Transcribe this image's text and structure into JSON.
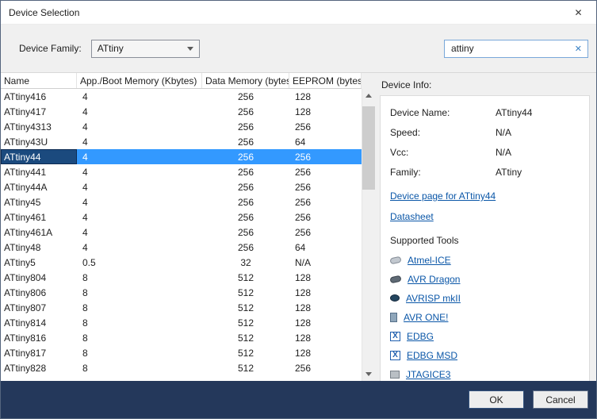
{
  "window": {
    "title": "Device Selection",
    "close_glyph": "✕"
  },
  "toolbar": {
    "device_family_label": "Device Family:",
    "device_family_value": "ATtiny",
    "search_value": "attiny",
    "search_clear": "✕"
  },
  "table": {
    "columns": [
      "Name",
      "App./Boot Memory (Kbytes)",
      "Data Memory (bytes)",
      "EEPROM (bytes)"
    ],
    "rows": [
      {
        "name": "ATtiny416",
        "app_boot": "4",
        "data_mem": "256",
        "eeprom": "128"
      },
      {
        "name": "ATtiny417",
        "app_boot": "4",
        "data_mem": "256",
        "eeprom": "128"
      },
      {
        "name": "ATtiny4313",
        "app_boot": "4",
        "data_mem": "256",
        "eeprom": "256"
      },
      {
        "name": "ATtiny43U",
        "app_boot": "4",
        "data_mem": "256",
        "eeprom": "64"
      },
      {
        "name": "ATtiny44",
        "app_boot": "4",
        "data_mem": "256",
        "eeprom": "256",
        "selected": true
      },
      {
        "name": "ATtiny441",
        "app_boot": "4",
        "data_mem": "256",
        "eeprom": "256"
      },
      {
        "name": "ATtiny44A",
        "app_boot": "4",
        "data_mem": "256",
        "eeprom": "256"
      },
      {
        "name": "ATtiny45",
        "app_boot": "4",
        "data_mem": "256",
        "eeprom": "256"
      },
      {
        "name": "ATtiny461",
        "app_boot": "4",
        "data_mem": "256",
        "eeprom": "256"
      },
      {
        "name": "ATtiny461A",
        "app_boot": "4",
        "data_mem": "256",
        "eeprom": "256"
      },
      {
        "name": "ATtiny48",
        "app_boot": "4",
        "data_mem": "256",
        "eeprom": "64"
      },
      {
        "name": "ATtiny5",
        "app_boot": "0.5",
        "data_mem": "32",
        "eeprom": "N/A"
      },
      {
        "name": "ATtiny804",
        "app_boot": "8",
        "data_mem": "512",
        "eeprom": "128"
      },
      {
        "name": "ATtiny806",
        "app_boot": "8",
        "data_mem": "512",
        "eeprom": "128"
      },
      {
        "name": "ATtiny807",
        "app_boot": "8",
        "data_mem": "512",
        "eeprom": "128"
      },
      {
        "name": "ATtiny814",
        "app_boot": "8",
        "data_mem": "512",
        "eeprom": "128"
      },
      {
        "name": "ATtiny816",
        "app_boot": "8",
        "data_mem": "512",
        "eeprom": "128"
      },
      {
        "name": "ATtiny817",
        "app_boot": "8",
        "data_mem": "512",
        "eeprom": "128"
      },
      {
        "name": "ATtiny828",
        "app_boot": "8",
        "data_mem": "512",
        "eeprom": "256"
      }
    ],
    "selected_device": "ATtiny44"
  },
  "device_info": {
    "title": "Device Info:",
    "fields": [
      {
        "label": "Device Name:",
        "value": "ATtiny44"
      },
      {
        "label": "Speed:",
        "value": "N/A"
      },
      {
        "label": "Vcc:",
        "value": "N/A"
      },
      {
        "label": "Family:",
        "value": "ATtiny"
      }
    ],
    "links": [
      {
        "label": "Device page for ATtiny44"
      },
      {
        "label": "Datasheet"
      }
    ],
    "supported_tools_title": "Supported Tools",
    "tools": [
      {
        "label": "Atmel-ICE",
        "icon": "atmel-ice-icon"
      },
      {
        "label": "AVR Dragon",
        "icon": "avr-dragon-icon"
      },
      {
        "label": "AVRISP mkII",
        "icon": "avrisp-mkii-icon"
      },
      {
        "label": "AVR ONE!",
        "icon": "avr-one-icon"
      },
      {
        "label": "EDBG",
        "icon": "edbg-icon"
      },
      {
        "label": "EDBG MSD",
        "icon": "edbg-msd-icon"
      },
      {
        "label": "JTAGICE3",
        "icon": "jtagice3-icon"
      }
    ]
  },
  "footer": {
    "ok_label": "OK",
    "cancel_label": "Cancel"
  },
  "colors": {
    "selection": "#3399ff",
    "selection_focus": "#1b4a7e",
    "footer_bg": "#24385b",
    "link": "#0b57a8"
  }
}
